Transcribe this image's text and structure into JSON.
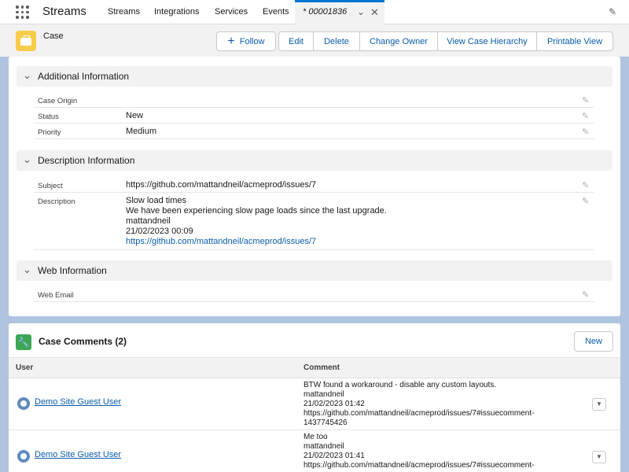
{
  "nav": {
    "app_name": "Streams",
    "items": [
      "Streams",
      "Integrations",
      "Services",
      "Events"
    ],
    "active_tab": "* 00001836",
    "icons": {
      "launcher": "app-launcher-icon",
      "chevron": "chevron-down-icon",
      "close": "close-icon",
      "edit": "pencil-icon"
    }
  },
  "record": {
    "object_label": "Case",
    "buttons": [
      "Follow",
      "Edit",
      "Delete",
      "Change Owner",
      "View Case Hierarchy",
      "Printable View"
    ]
  },
  "sections": {
    "additional": {
      "title": "Additional Information",
      "fields": [
        {
          "label": "Case Origin",
          "value": ""
        },
        {
          "label": "Status",
          "value": "New"
        },
        {
          "label": "Priority",
          "value": "Medium"
        }
      ]
    },
    "description": {
      "title": "Description Information",
      "subject_label": "Subject",
      "subject_value": "https://github.com/mattandneil/acmeprod/issues/7",
      "description_label": "Description",
      "description_lines": [
        "Slow load times",
        "We have been experiencing slow page loads since the last upgrade.",
        "mattandneil",
        "21/02/2023 00:09"
      ],
      "description_link": "https://github.com/mattandneil/acmeprod/issues/7"
    },
    "web": {
      "title": "Web Information",
      "fields": [
        {
          "label": "Web Email",
          "value": ""
        }
      ]
    }
  },
  "comments": {
    "title": "Case Comments (2)",
    "new_label": "New",
    "columns": [
      "User",
      "Comment"
    ],
    "rows": [
      {
        "user": "Demo Site Guest User",
        "lines": [
          "BTW found a workaround - disable any custom layouts.",
          "mattandneil",
          "21/02/2023 01:42",
          "https://github.com/mattandneil/acmeprod/issues/7#issuecomment-",
          "1437745426"
        ]
      },
      {
        "user": "Demo Site Guest User",
        "lines": [
          "Me too",
          "mattandneil",
          "21/02/2023 01:41",
          "https://github.com/mattandneil/acmeprod/issues/7#issuecomment-"
        ]
      }
    ]
  }
}
